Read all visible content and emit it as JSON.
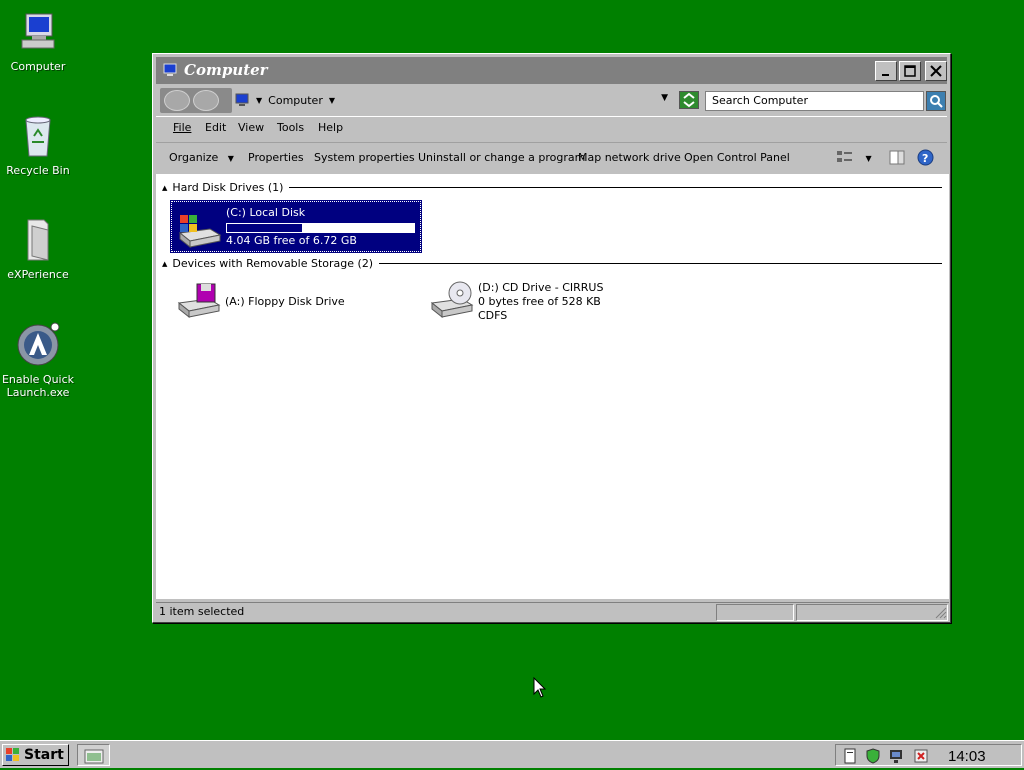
{
  "desktop": {
    "icons": [
      {
        "label": "Computer",
        "icon": "computer-icon"
      },
      {
        "label": "Recycle Bin",
        "icon": "recycle-bin-icon"
      },
      {
        "label": "eXPerience",
        "icon": "folder-icon"
      },
      {
        "label": "Enable Quick Launch.exe",
        "icon": "quick-launch-icon"
      }
    ]
  },
  "window": {
    "title": "Computer",
    "address": {
      "location": "Computer",
      "search_placeholder": "Search Computer"
    },
    "menu": [
      "File",
      "Edit",
      "View",
      "Tools",
      "Help"
    ],
    "commands": [
      "Organize",
      "Properties",
      "System properties",
      "Uninstall or change a program",
      "Map network drive",
      "Open Control Panel"
    ],
    "groups": {
      "hard_disk": "Hard Disk Drives (1)",
      "removable": "Devices with Removable Storage (2)"
    },
    "drives": {
      "c": {
        "name": "(C:) Local Disk",
        "free": "4.04 GB free of 6.72 GB",
        "used_fraction": 0.4
      },
      "a": {
        "name": "(A:) Floppy Disk Drive"
      },
      "d": {
        "name": "(D:) CD Drive - CIRRUS",
        "free": "0 bytes free of 528 KB",
        "fs": "CDFS"
      }
    },
    "status": "1 item selected"
  },
  "taskbar": {
    "start_label": "Start",
    "clock": "14:03"
  },
  "colors": {
    "desktop": "#008000",
    "selection": "#000080",
    "window_face": "#c0c0c0"
  }
}
